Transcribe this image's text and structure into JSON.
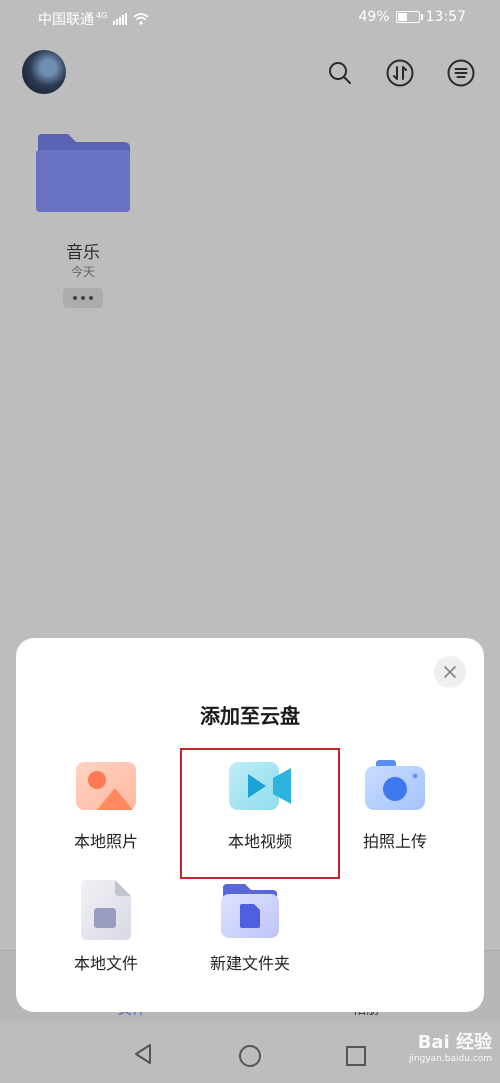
{
  "status_bar": {
    "carrier": "中国联通",
    "network": "4G",
    "battery": "49%",
    "battery_level": 0.49,
    "time": "13:57"
  },
  "folder": {
    "name": "音乐",
    "date": "今天"
  },
  "sheet": {
    "title": "添加至云盘",
    "options": [
      {
        "label": "本地照片",
        "icon": "photo-icon"
      },
      {
        "label": "本地视频",
        "icon": "video-icon"
      },
      {
        "label": "拍照上传",
        "icon": "camera-icon"
      },
      {
        "label": "本地文件",
        "icon": "file-icon"
      },
      {
        "label": "新建文件夹",
        "icon": "new-folder-icon"
      }
    ]
  },
  "bottom_nav": {
    "left": "文件",
    "right": "相册"
  },
  "watermark": {
    "text": "Bai 经验",
    "sub": "jingyan.baidu.com"
  }
}
